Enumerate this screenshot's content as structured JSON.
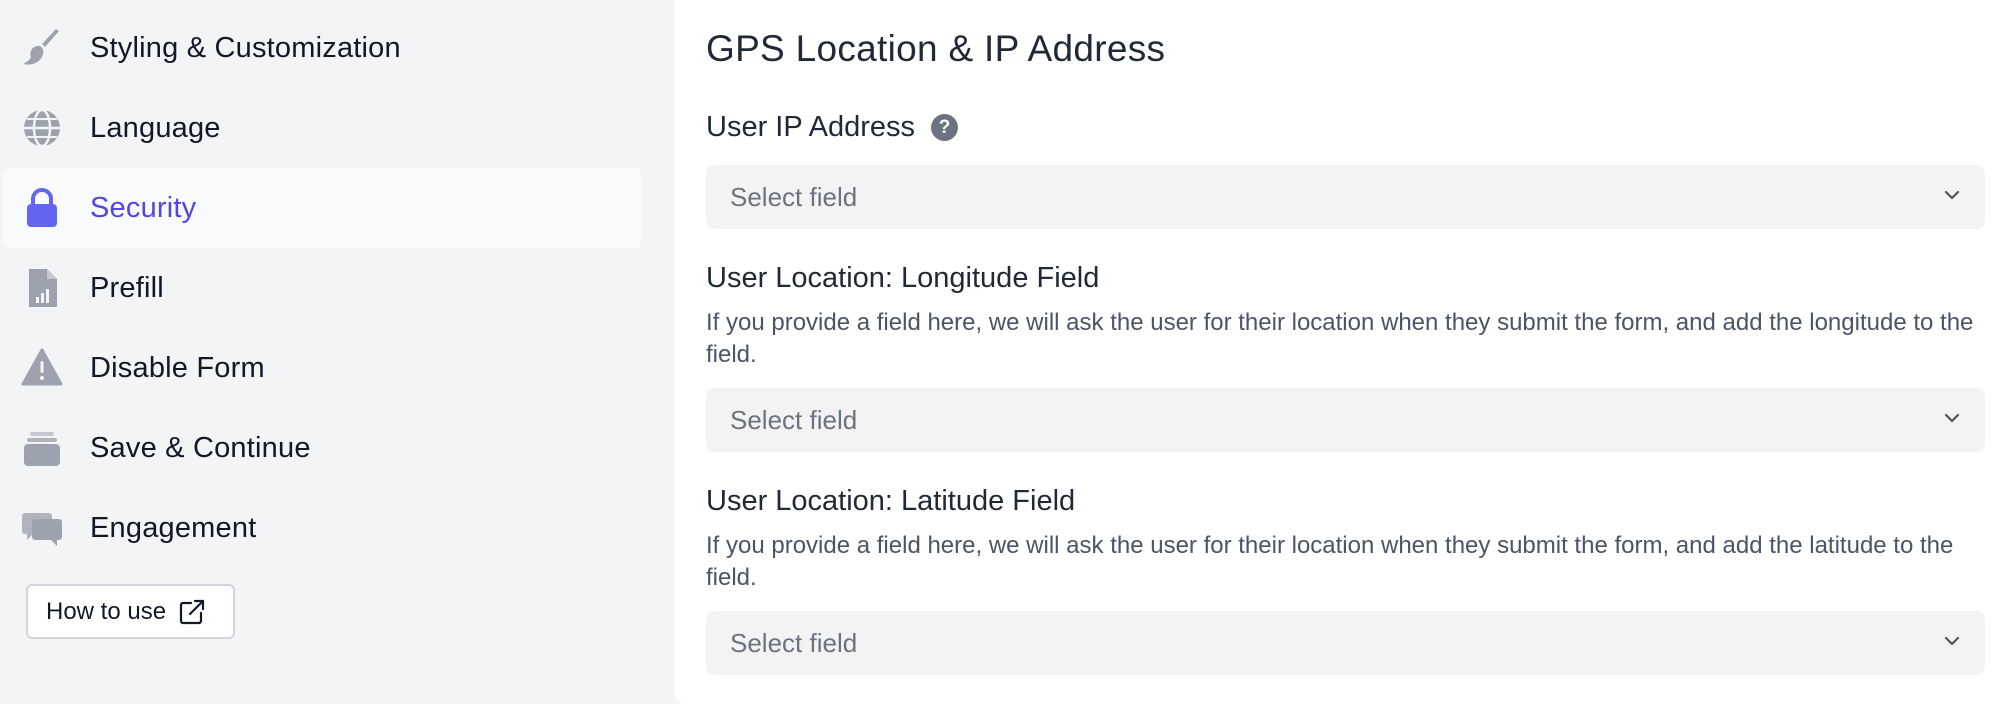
{
  "sidebar": {
    "items": [
      {
        "label": "Styling & Customization",
        "icon": "paintbrush-icon",
        "active": false
      },
      {
        "label": "Language",
        "icon": "globe-icon",
        "active": false
      },
      {
        "label": "Security",
        "icon": "lock-icon",
        "active": true
      },
      {
        "label": "Prefill",
        "icon": "document-chart-icon",
        "active": false
      },
      {
        "label": "Disable Form",
        "icon": "warning-icon",
        "active": false
      },
      {
        "label": "Save & Continue",
        "icon": "stack-icon",
        "active": false
      },
      {
        "label": "Engagement",
        "icon": "chat-bubbles-icon",
        "active": false
      }
    ],
    "how_to_use_label": "How to use"
  },
  "main": {
    "title": "GPS Location & IP Address",
    "fields": [
      {
        "label": "User IP Address",
        "has_help": true,
        "description": "",
        "select_value": "Select field"
      },
      {
        "label": "User Location: Longitude Field",
        "has_help": false,
        "description": "If you provide a field here, we will ask the user for their location when they submit the form, and add the longitude to the field.",
        "select_value": "Select field"
      },
      {
        "label": "User Location: Latitude Field",
        "has_help": false,
        "description": "If you provide a field here, we will ask the user for their location when they submit the form, and add the latitude to the field.",
        "select_value": "Select field"
      }
    ],
    "help_glyph": "?"
  },
  "colors": {
    "accent": "#4f46e5",
    "icon_gray": "#9ca3af",
    "sidebar_bg": "#f3f4f6",
    "select_bg": "#f3f3f3"
  }
}
